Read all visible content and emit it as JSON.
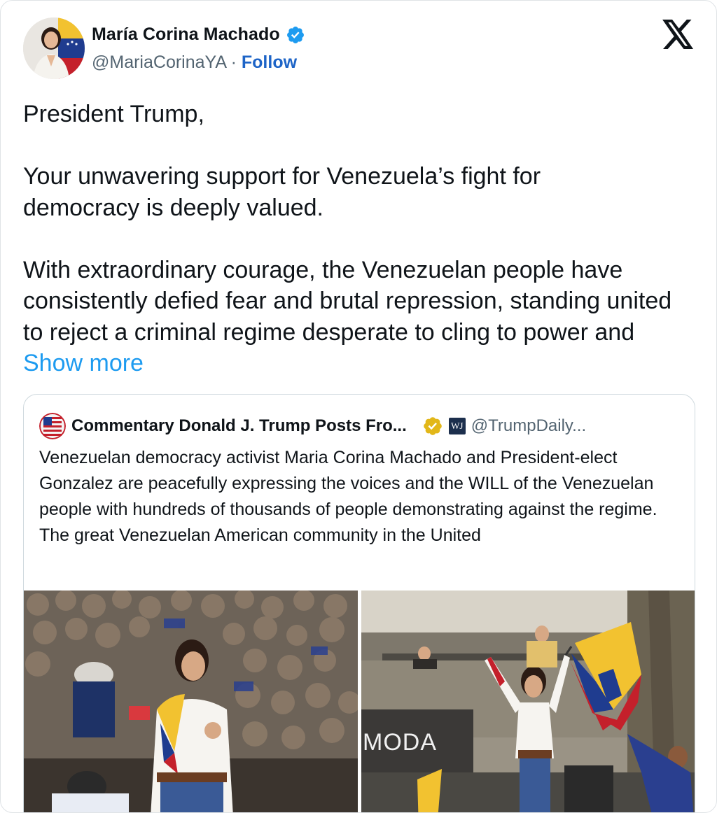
{
  "author": {
    "name": "María Corina Machado",
    "handle": "@MariaCorinaYA",
    "separator": "·",
    "follow_label": "Follow"
  },
  "icons": {
    "verified": "verified-badge-icon",
    "x_logo": "x-logo-icon",
    "gold_badge": "gold-verified-badge-icon"
  },
  "tweet": {
    "greeting": "President Trump,",
    "para1": "Your unwavering support for Venezuela’s fight for democracy is deeply valued.",
    "para2": "With extraordinary courage, the Venezuelan people have consistently defied fear and brutal repression, standing united to reject a criminal regime desperate to cling to power and",
    "show_more": "Show more"
  },
  "quote": {
    "name": "Commentary Donald J. Trump Posts Fro...",
    "badge_text": "WJ",
    "handle": "@TrumpDaily...",
    "text": "Venezuelan democracy activist Maria Corina Machado and President-elect Gonzalez are peacefully expressing the voices and the WILL of the Venezuelan people with hundreds of thousands of people demonstrating against the regime. The great Venezuelan American community in the United",
    "image2_sign": "MODA"
  },
  "colors": {
    "link": "#1d9bf0",
    "follow": "#1d64c7",
    "verified": "#1d9bf0",
    "gold": "#e2b719",
    "muted": "#536471"
  }
}
